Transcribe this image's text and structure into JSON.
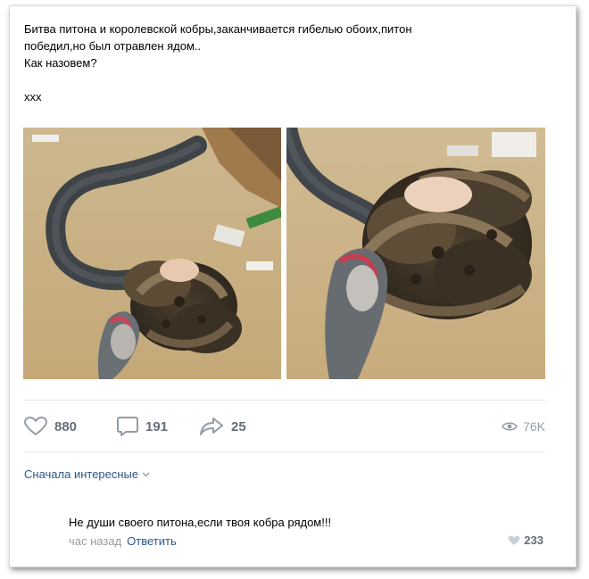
{
  "post": {
    "text_lines": [
      "Битва питона и королевской кобры,заканчивается гибелью обоих,питон",
      "победил,но был отравлен ядом..",
      "Как назовем?",
      "",
      "xxx"
    ]
  },
  "actions": {
    "likes": "880",
    "comments": "191",
    "shares": "25",
    "views": "76K"
  },
  "icons": {
    "like": "heart-icon",
    "comment": "speech-bubble-icon",
    "share": "share-arrow-icon",
    "views": "eye-icon",
    "sort": "chevron-down-icon",
    "comment_like": "heart-icon"
  },
  "comments_section": {
    "sort_label": "Сначала интересные"
  },
  "comment": {
    "text": "Не души своего питона,если твоя кобра рядом!!!",
    "time": "час назад",
    "reply_label": "Ответить",
    "likes": "233"
  },
  "colors": {
    "link": "#2a5885",
    "icon_gray": "#939ca6",
    "count_gray": "#656e78"
  }
}
